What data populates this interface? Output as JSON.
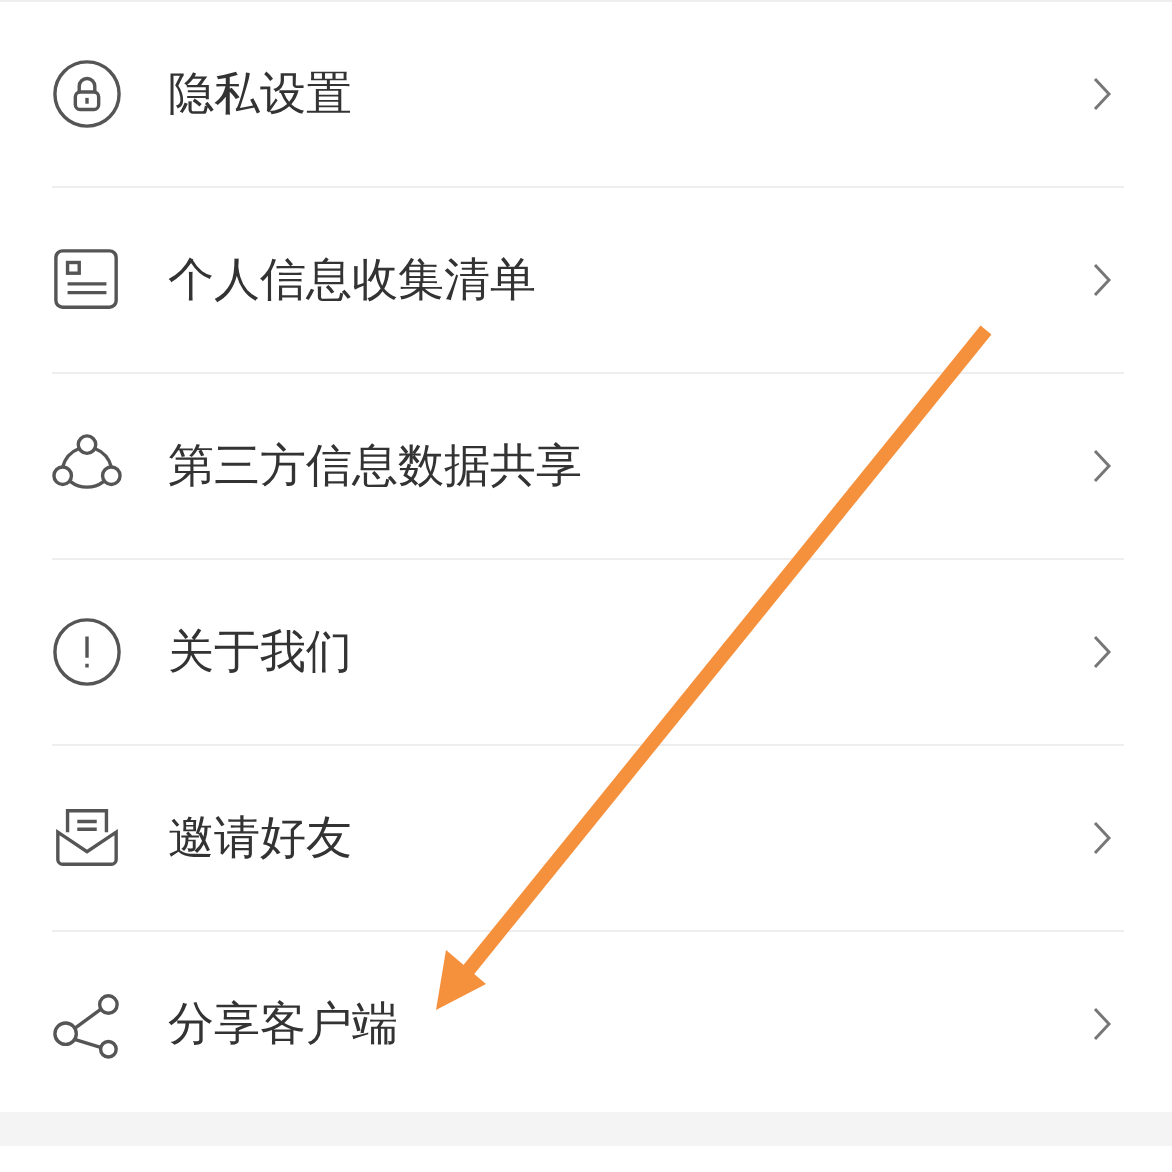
{
  "menu": [
    {
      "label": "隐私设置"
    },
    {
      "label": "个人信息收集清单"
    },
    {
      "label": "第三方信息数据共享"
    },
    {
      "label": "关于我们"
    },
    {
      "label": "邀请好友"
    },
    {
      "label": "分享客户端"
    }
  ]
}
